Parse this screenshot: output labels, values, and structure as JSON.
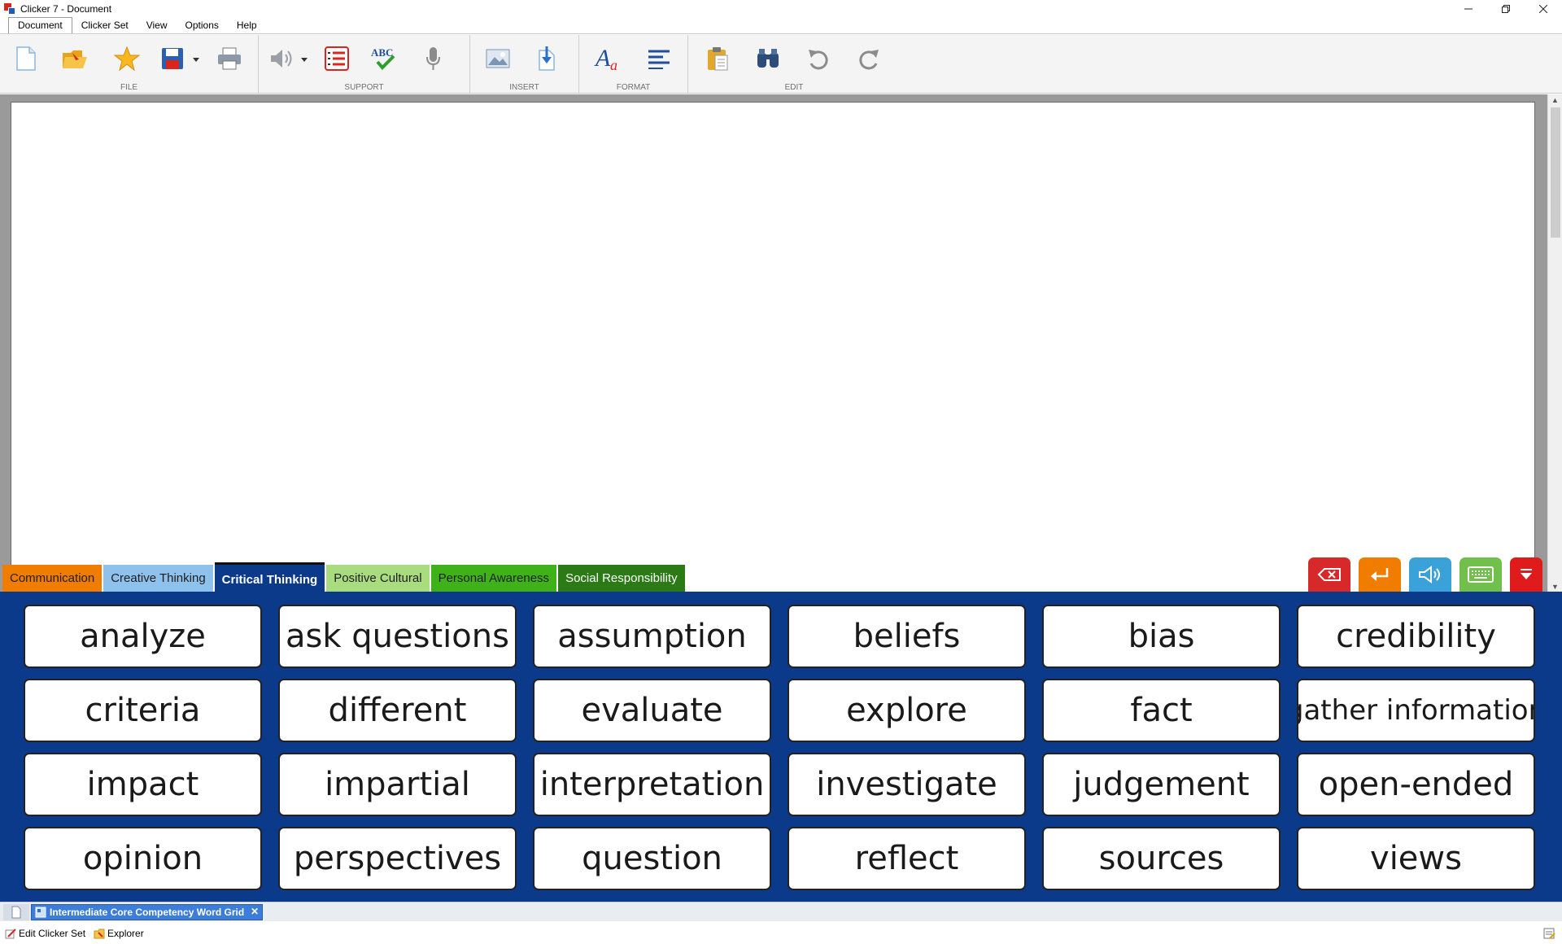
{
  "window": {
    "title": "Clicker 7 - Document",
    "controls": [
      "minimize",
      "restore",
      "close"
    ]
  },
  "menu": {
    "items": [
      {
        "label": "Document",
        "active": true
      },
      {
        "label": "Clicker Set"
      },
      {
        "label": "View"
      },
      {
        "label": "Options"
      },
      {
        "label": "Help"
      }
    ]
  },
  "toolbar": {
    "groups": {
      "file": "FILE",
      "support": "SUPPORT",
      "insert": "INSERT",
      "format": "FORMAT",
      "edit": "EDIT"
    },
    "icons": [
      "new-document-icon",
      "open-folder-icon",
      "favorite-star-icon",
      "save-icon",
      "print-icon",
      "speech-icon",
      "word-list-icon",
      "spell-check-icon",
      "microphone-icon",
      "picture-icon",
      "insert-file-icon",
      "font-icon",
      "align-icon",
      "paste-icon",
      "find-icon",
      "undo-icon",
      "redo-icon"
    ],
    "spell_check_text": "ABC",
    "font_icon_text": "A"
  },
  "tabs": [
    {
      "label": "Communication",
      "color": "#f07d00",
      "active": false
    },
    {
      "label": "Creative Thinking",
      "color": "#8ec1ec",
      "active": false
    },
    {
      "label": "Critical Thinking",
      "color": "#0c3a8a",
      "active": true
    },
    {
      "label": "Positive Cultural",
      "color": "#a9dc7f",
      "active": false
    },
    {
      "label": "Personal Awareness",
      "color": "#3fb21a",
      "active": false
    },
    {
      "label": "Social Responsibility",
      "color": "#2b7a16",
      "active": false
    }
  ],
  "controls": {
    "backspace_color": "#d7282a",
    "enter_color": "#f07d00",
    "speak_color": "#3ba1d9",
    "keyboard_color": "#70c04b",
    "minimize_grid_color": "#e01b1b"
  },
  "grid": {
    "background": "#0c3a8a",
    "words": [
      "analyze",
      "ask  questions",
      "assumption",
      "beliefs",
      "bias",
      "credibility",
      "criteria",
      "different",
      "evaluate",
      "explore",
      "fact",
      "gather information",
      "impact",
      "impartial",
      "interpretation",
      "investigate",
      "judgement",
      "open-ended",
      "opinion",
      "perspectives",
      "question",
      "reflect",
      "sources",
      "views"
    ]
  },
  "set_tabs": {
    "active": "Intermediate Core Competency Word Grid"
  },
  "status": {
    "edit_set": "Edit Clicker Set",
    "explorer": "Explorer"
  }
}
